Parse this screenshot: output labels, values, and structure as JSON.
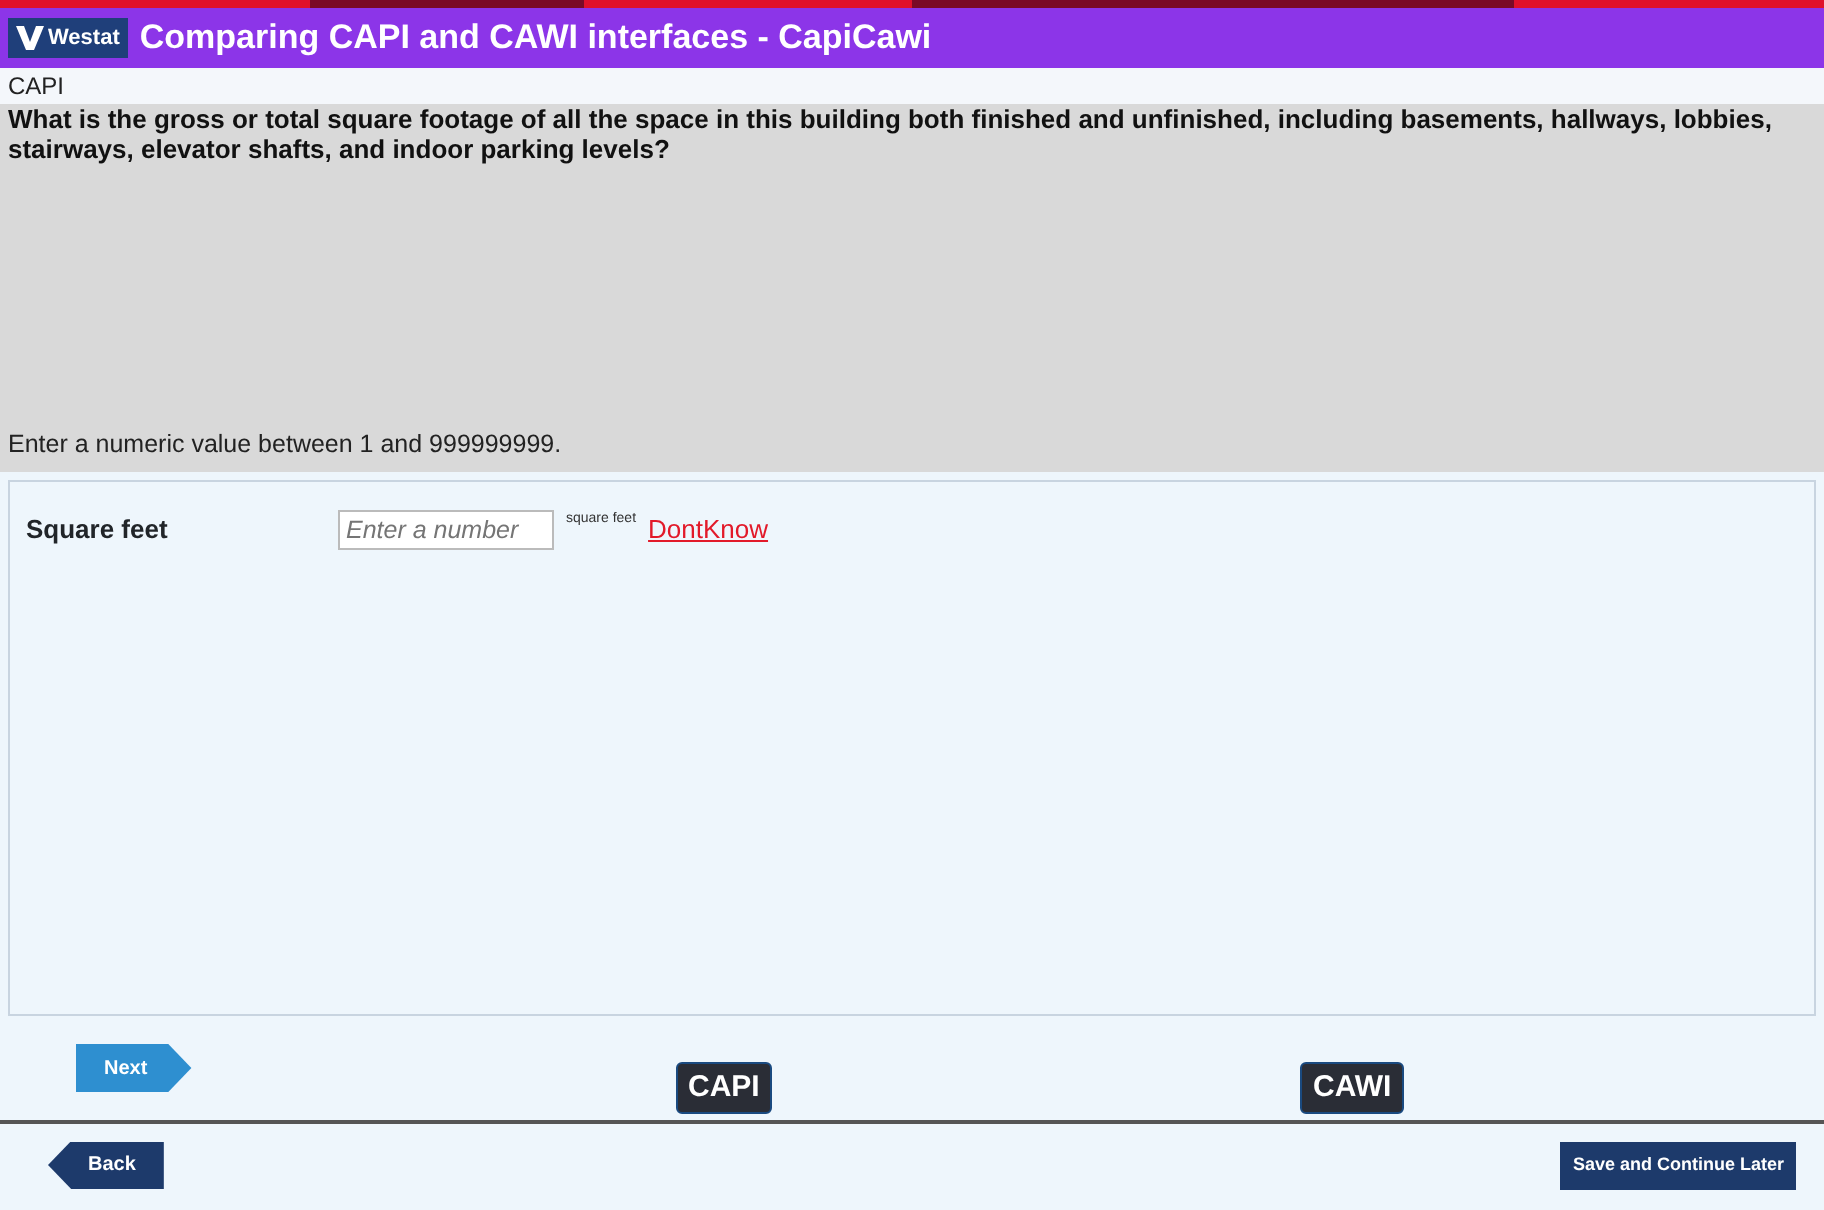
{
  "header": {
    "logo": "Westat",
    "title": "Comparing CAPI and CAWI interfaces - CapiCawi"
  },
  "mode_label": "CAPI",
  "question": "What is the gross or total square footage of all the space in this building both finished and unfinished, including basements, hallways, lobbies, stairways, elevator shafts, and indoor parking levels?",
  "instruction": "Enter a numeric value between 1 and 999999999.",
  "answer": {
    "label": "Square feet",
    "placeholder": "Enter a number",
    "unit": "square feet",
    "dont_know": "DontKnow"
  },
  "nav": {
    "next": "Next",
    "mode_buttons": [
      "CAPI",
      "CAWI"
    ],
    "back": "Back",
    "save": "Save and Continue Later"
  }
}
